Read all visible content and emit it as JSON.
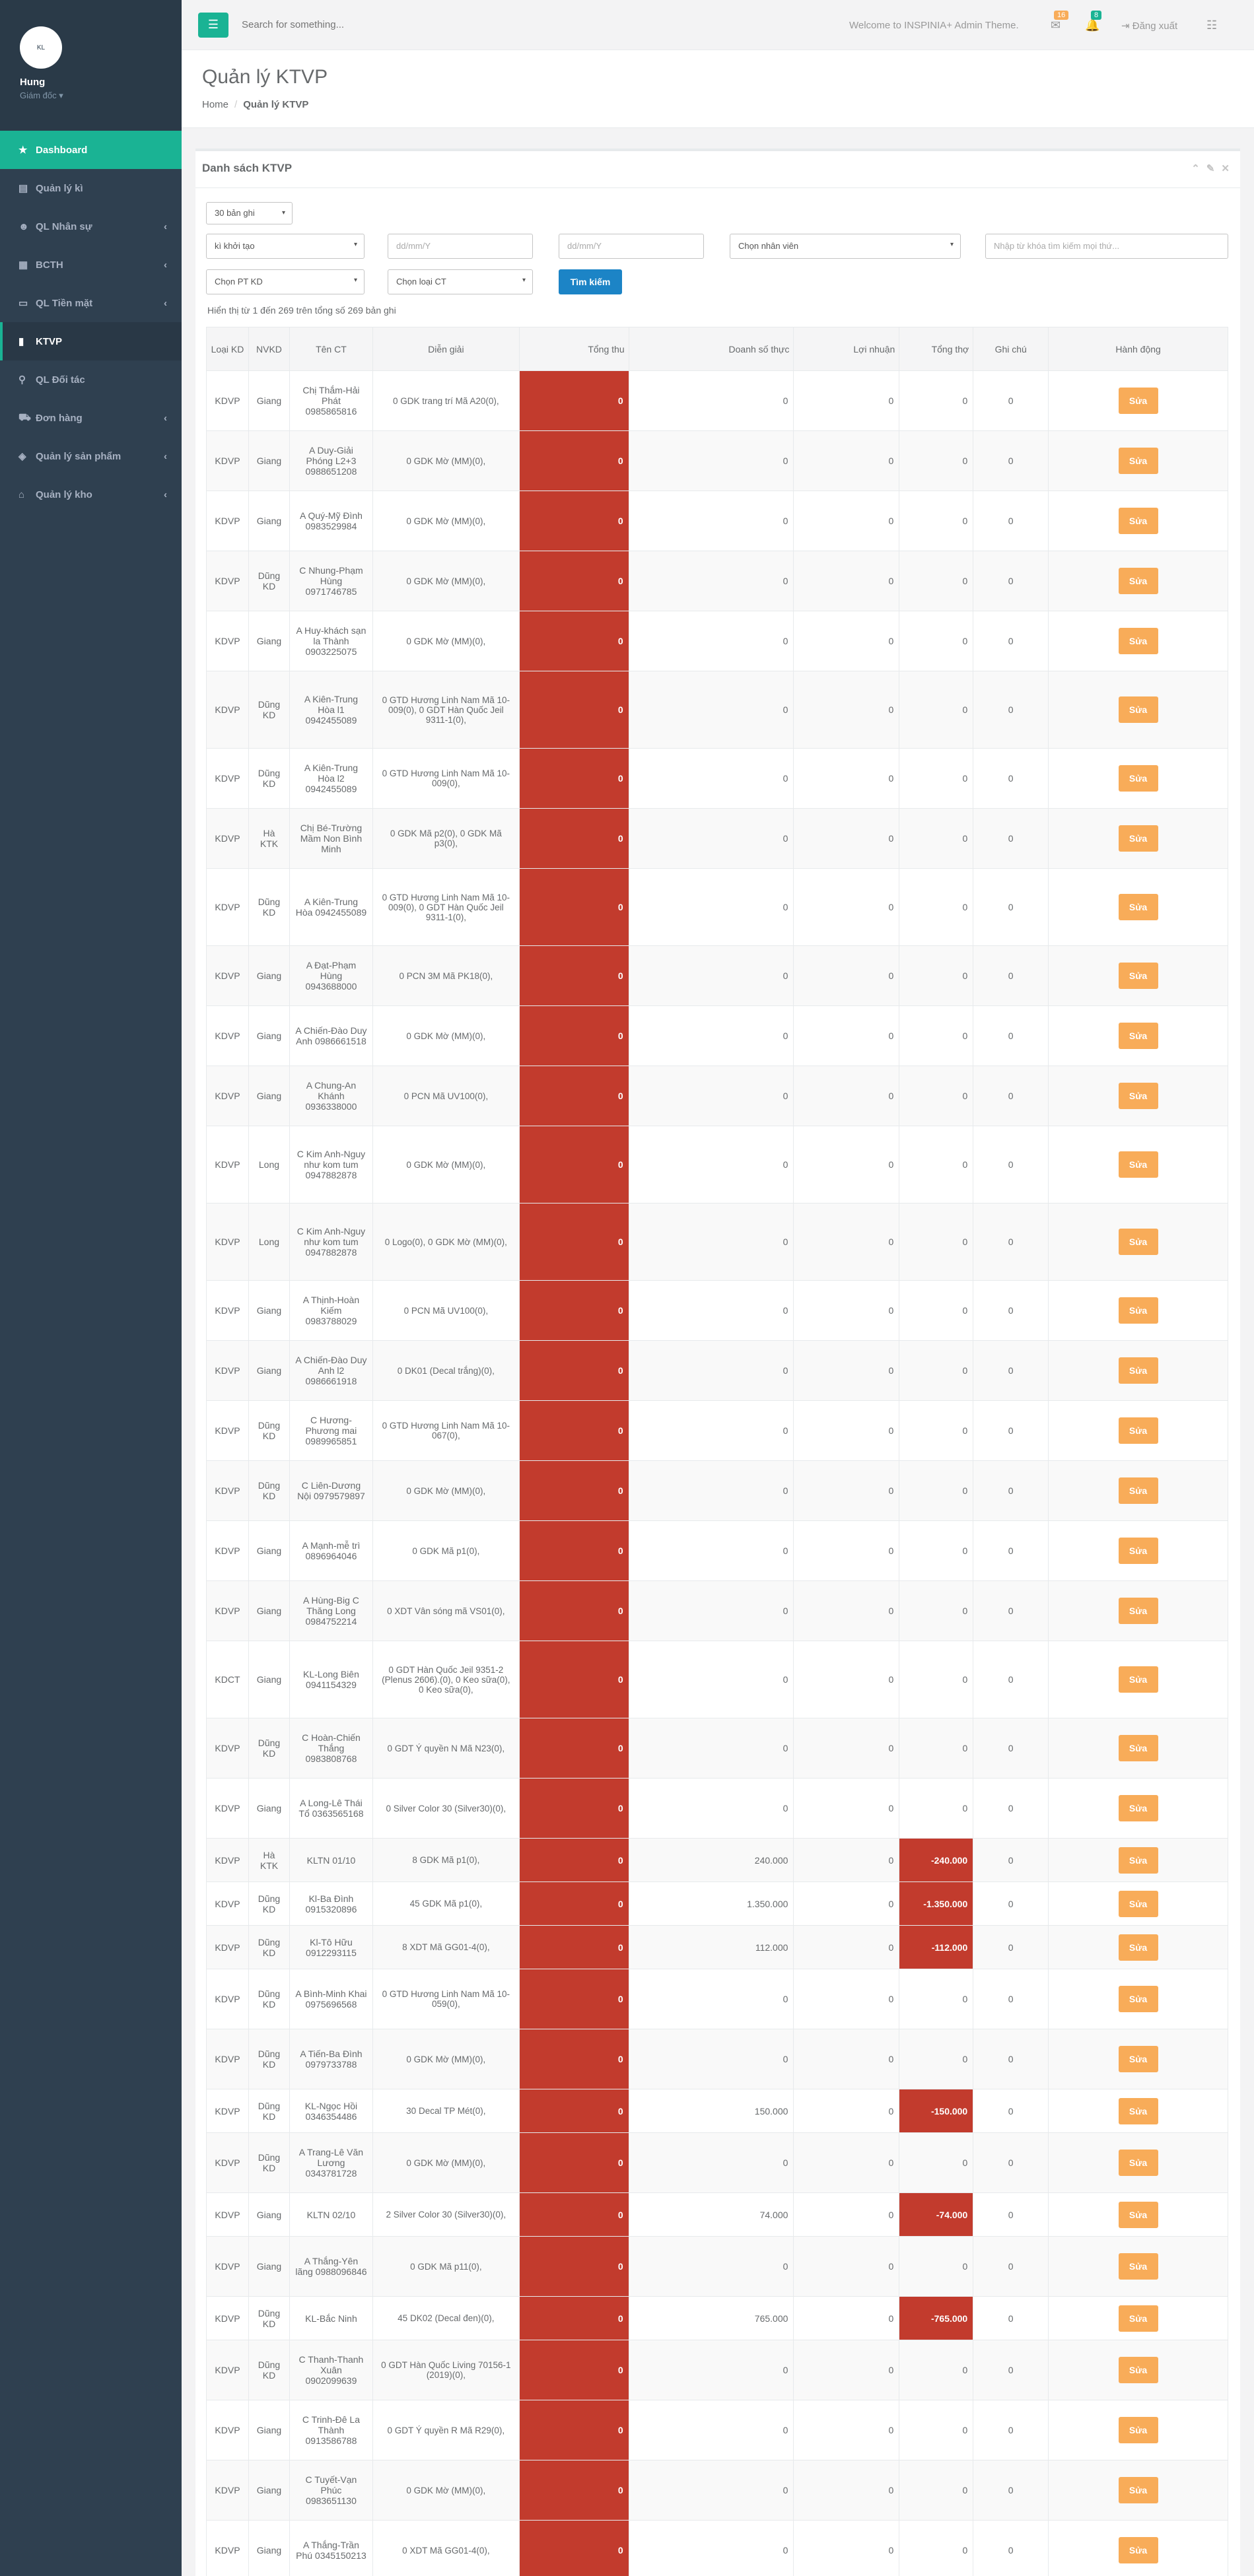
{
  "sidebar": {
    "avatar_text": "KL",
    "profile_name": "Hung",
    "profile_role": "Giám đốc",
    "items": [
      {
        "label": "Dashboard",
        "icon": "★"
      },
      {
        "label": "Quản lý kì",
        "icon": "▤"
      },
      {
        "label": "QL Nhân sự",
        "icon": "☻"
      },
      {
        "label": "BCTH",
        "icon": "▦"
      },
      {
        "label": "QL Tiền mặt",
        "icon": "▭"
      },
      {
        "label": "KTVP",
        "icon": "▮"
      },
      {
        "label": "QL Đối tác",
        "icon": "⚲"
      },
      {
        "label": "Đơn hàng",
        "icon": "⛟"
      },
      {
        "label": "Quản lý sản phẩm",
        "icon": "◈"
      },
      {
        "label": "Quản lý kho",
        "icon": "⌂"
      }
    ]
  },
  "topbar": {
    "search_placeholder": "Search for something...",
    "welcome": "Welcome to INSPINIA+ Admin Theme.",
    "mail_count": "16",
    "bell_count": "8",
    "logout": "Đăng xuất"
  },
  "heading": {
    "title": "Quản lý KTVP",
    "crumb_home": "Home",
    "crumb_current": "Quản lý KTVP"
  },
  "panel": {
    "title": "Danh sách KTVP",
    "page_size": "30 bản ghi",
    "ki_select": "kì khởi tạo",
    "date_from_placeholder": "dd/mm/Y",
    "date_to_placeholder": "dd/mm/Y",
    "staff_select": "Chọn nhân viên",
    "keyword_placeholder": "Nhập từ khóa tìm kiếm mọi thứ...",
    "pt_select": "Chọn PT KD",
    "ct_select": "Chọn loại CT",
    "search_button": "Tìm kiếm",
    "info": "Hiển thị từ 1 đến 269 trên tổng số 269 bản ghi"
  },
  "table": {
    "headers": [
      "Loại KD",
      "NVKD",
      "Tên CT",
      "Diễn giải",
      "Tổng thu",
      "Doanh số thực",
      "Lợi nhuận",
      "Tổng thợ",
      "Ghi chú",
      "Hành động"
    ],
    "edit_label": "Sửa",
    "rows": [
      {
        "loai": "KDVP",
        "nvkd": "Giang",
        "ten": "Chị Thắm-Hải Phát 0985865816",
        "dien": "0 GDK trang trí Mã A20(0),",
        "thu": "0",
        "ds": "0",
        "ln": "0",
        "tho": "0",
        "gc": "0"
      },
      {
        "loai": "KDVP",
        "nvkd": "Giang",
        "ten": "A Duy-Giải Phóng L2+3 0988651208",
        "dien": "0 GDK Mờ (MM)(0),",
        "thu": "0",
        "ds": "0",
        "ln": "0",
        "tho": "0",
        "gc": "0"
      },
      {
        "loai": "KDVP",
        "nvkd": "Giang",
        "ten": "A Quý-Mỹ Đình 0983529984",
        "dien": "0 GDK Mờ (MM)(0),",
        "thu": "0",
        "ds": "0",
        "ln": "0",
        "tho": "0",
        "gc": "0"
      },
      {
        "loai": "KDVP",
        "nvkd": "Dũng KD",
        "ten": "C Nhung-Phạm Hùng 0971746785",
        "dien": "0 GDK Mờ (MM)(0),",
        "thu": "0",
        "ds": "0",
        "ln": "0",
        "tho": "0",
        "gc": "0"
      },
      {
        "loai": "KDVP",
        "nvkd": "Giang",
        "ten": "A Huy-khách sạn la Thành 0903225075",
        "dien": "0 GDK Mờ (MM)(0),",
        "thu": "0",
        "ds": "0",
        "ln": "0",
        "tho": "0",
        "gc": "0"
      },
      {
        "loai": "KDVP",
        "nvkd": "Dũng KD",
        "ten": "A Kiên-Trung Hòa l1 0942455089",
        "dien": "0 GTD Hương Linh Nam Mã 10-009(0), 0 GDT Hàn Quốc Jeil 9311-1(0),",
        "thu": "0",
        "ds": "0",
        "ln": "0",
        "tho": "0",
        "gc": "0"
      },
      {
        "loai": "KDVP",
        "nvkd": "Dũng KD",
        "ten": "A Kiên-Trung Hòa l2 0942455089",
        "dien": "0 GTD Hương Linh Nam Mã 10-009(0),",
        "thu": "0",
        "ds": "0",
        "ln": "0",
        "tho": "0",
        "gc": "0"
      },
      {
        "loai": "KDVP",
        "nvkd": "Hà KTK",
        "ten": "Chị Bé-Trường Mầm Non Bình Minh",
        "dien": "0 GDK Mã p2(0), 0 GDK Mã p3(0),",
        "thu": "0",
        "ds": "0",
        "ln": "0",
        "tho": "0",
        "gc": "0"
      },
      {
        "loai": "KDVP",
        "nvkd": "Dũng KD",
        "ten": "A Kiên-Trung Hòa 0942455089",
        "dien": "0 GTD Hương Linh Nam Mã 10-009(0), 0 GDT Hàn Quốc Jeil 9311-1(0),",
        "thu": "0",
        "ds": "0",
        "ln": "0",
        "tho": "0",
        "gc": "0"
      },
      {
        "loai": "KDVP",
        "nvkd": "Giang",
        "ten": "A Đạt-Phạm Hùng 0943688000",
        "dien": "0 PCN 3M Mã PK18(0),",
        "thu": "0",
        "ds": "0",
        "ln": "0",
        "tho": "0",
        "gc": "0"
      },
      {
        "loai": "KDVP",
        "nvkd": "Giang",
        "ten": "A Chiến-Đào Duy Anh 0986661518",
        "dien": "0 GDK Mờ (MM)(0),",
        "thu": "0",
        "ds": "0",
        "ln": "0",
        "tho": "0",
        "gc": "0"
      },
      {
        "loai": "KDVP",
        "nvkd": "Giang",
        "ten": "A Chung-An Khánh 0936338000",
        "dien": "0 PCN Mã UV100(0),",
        "thu": "0",
        "ds": "0",
        "ln": "0",
        "tho": "0",
        "gc": "0"
      },
      {
        "loai": "KDVP",
        "nvkd": "Long",
        "ten": "C Kim Anh-Nguy như kom tum 0947882878",
        "dien": "0 GDK Mờ (MM)(0),",
        "thu": "0",
        "ds": "0",
        "ln": "0",
        "tho": "0",
        "gc": "0"
      },
      {
        "loai": "KDVP",
        "nvkd": "Long",
        "ten": "C Kim Anh-Nguy như kom tum 0947882878",
        "dien": "0 Logo(0), 0 GDK Mờ (MM)(0),",
        "thu": "0",
        "ds": "0",
        "ln": "0",
        "tho": "0",
        "gc": "0"
      },
      {
        "loai": "KDVP",
        "nvkd": "Giang",
        "ten": "A Thịnh-Hoàn Kiếm 0983788029",
        "dien": "0 PCN Mã UV100(0),",
        "thu": "0",
        "ds": "0",
        "ln": "0",
        "tho": "0",
        "gc": "0"
      },
      {
        "loai": "KDVP",
        "nvkd": "Giang",
        "ten": "A Chiến-Đào Duy Anh l2 0986661918",
        "dien": "0 DK01 (Decal trắng)(0),",
        "thu": "0",
        "ds": "0",
        "ln": "0",
        "tho": "0",
        "gc": "0"
      },
      {
        "loai": "KDVP",
        "nvkd": "Dũng KD",
        "ten": "C Hương-Phương mai 0989965851",
        "dien": "0 GTD Hương Linh Nam Mã 10-067(0),",
        "thu": "0",
        "ds": "0",
        "ln": "0",
        "tho": "0",
        "gc": "0"
      },
      {
        "loai": "KDVP",
        "nvkd": "Dũng KD",
        "ten": "C Liên-Dương Nội 0979579897",
        "dien": "0 GDK Mờ (MM)(0),",
        "thu": "0",
        "ds": "0",
        "ln": "0",
        "tho": "0",
        "gc": "0"
      },
      {
        "loai": "KDVP",
        "nvkd": "Giang",
        "ten": "A Mạnh-mễ trì 0896964046",
        "dien": "0 GDK Mã p1(0),",
        "thu": "0",
        "ds": "0",
        "ln": "0",
        "tho": "0",
        "gc": "0"
      },
      {
        "loai": "KDVP",
        "nvkd": "Giang",
        "ten": "A Hùng-Big C Thăng Long 0984752214",
        "dien": "0 XDT Vân sóng mã VS01(0),",
        "thu": "0",
        "ds": "0",
        "ln": "0",
        "tho": "0",
        "gc": "0"
      },
      {
        "loai": "KDCT",
        "nvkd": "Giang",
        "ten": "KL-Long Biên 0941154329",
        "dien": "0 GDT Hàn Quốc Jeil 9351-2 (Plenus 2606).(0), 0 Keo sữa(0), 0 Keo sữa(0),",
        "thu": "0",
        "ds": "0",
        "ln": "0",
        "tho": "0",
        "gc": "0"
      },
      {
        "loai": "KDVP",
        "nvkd": "Dũng KD",
        "ten": "C Hoàn-Chiến Thắng 0983808768",
        "dien": "0 GDT Ý quyền N Mã N23(0),",
        "thu": "0",
        "ds": "0",
        "ln": "0",
        "tho": "0",
        "gc": "0"
      },
      {
        "loai": "KDVP",
        "nvkd": "Giang",
        "ten": "A Long-Lê Thái Tổ 0363565168",
        "dien": "0 Silver Color 30 (Silver30)(0),",
        "thu": "0",
        "ds": "0",
        "ln": "0",
        "tho": "0",
        "gc": "0"
      },
      {
        "loai": "KDVP",
        "nvkd": "Hà KTK",
        "ten": "KLTN 01/10",
        "dien": "8 GDK Mã p1(0),",
        "thu": "0",
        "ds": "240.000",
        "ln": "0",
        "tho": "-240.000",
        "gc": "0",
        "red_tho": true
      },
      {
        "loai": "KDVP",
        "nvkd": "Dũng KD",
        "ten": "Kl-Ba Đình 0915320896",
        "dien": "45 GDK Mã p1(0),",
        "thu": "0",
        "ds": "1.350.000",
        "ln": "0",
        "tho": "-1.350.000",
        "gc": "0",
        "red_tho": true
      },
      {
        "loai": "KDVP",
        "nvkd": "Dũng KD",
        "ten": "Kl-Tô Hữu 0912293115",
        "dien": "8 XDT Mã GG01-4(0),",
        "thu": "0",
        "ds": "112.000",
        "ln": "0",
        "tho": "-112.000",
        "gc": "0",
        "red_tho": true
      },
      {
        "loai": "KDVP",
        "nvkd": "Dũng KD",
        "ten": "A Bình-Minh Khai 0975696568",
        "dien": "0 GTD Hương Linh Nam Mã 10-059(0),",
        "thu": "0",
        "ds": "0",
        "ln": "0",
        "tho": "0",
        "gc": "0"
      },
      {
        "loai": "KDVP",
        "nvkd": "Dũng KD",
        "ten": "A Tiến-Ba Đình 0979733788",
        "dien": "0 GDK Mờ (MM)(0),",
        "thu": "0",
        "ds": "0",
        "ln": "0",
        "tho": "0",
        "gc": "0"
      },
      {
        "loai": "KDVP",
        "nvkd": "Dũng KD",
        "ten": "KL-Ngọc Hồi 0346354486",
        "dien": "30 Decal TP Mét(0),",
        "thu": "0",
        "ds": "150.000",
        "ln": "0",
        "tho": "-150.000",
        "gc": "0",
        "red_tho": true
      },
      {
        "loai": "KDVP",
        "nvkd": "Dũng KD",
        "ten": "A Trang-Lê Văn Lương 0343781728",
        "dien": "0 GDK Mờ (MM)(0),",
        "thu": "0",
        "ds": "0",
        "ln": "0",
        "tho": "0",
        "gc": "0"
      },
      {
        "loai": "KDVP",
        "nvkd": "Giang",
        "ten": "KLTN 02/10",
        "dien": "2 Silver Color 30 (Silver30)(0),",
        "thu": "0",
        "ds": "74.000",
        "ln": "0",
        "tho": "-74.000",
        "gc": "0",
        "red_tho": true
      },
      {
        "loai": "KDVP",
        "nvkd": "Giang",
        "ten": "A Thắng-Yên lãng 0988096846",
        "dien": "0 GDK Mã p11(0),",
        "thu": "0",
        "ds": "0",
        "ln": "0",
        "tho": "0",
        "gc": "0"
      },
      {
        "loai": "KDVP",
        "nvkd": "Dũng KD",
        "ten": "KL-Bắc Ninh",
        "dien": "45 DK02 (Decal đen)(0),",
        "thu": "0",
        "ds": "765.000",
        "ln": "0",
        "tho": "-765.000",
        "gc": "0",
        "red_tho": true
      },
      {
        "loai": "KDVP",
        "nvkd": "Dũng KD",
        "ten": "C Thanh-Thanh Xuân 0902099639",
        "dien": "0 GDT Hàn Quốc Living 70156-1 (2019)(0),",
        "thu": "0",
        "ds": "0",
        "ln": "0",
        "tho": "0",
        "gc": "0"
      },
      {
        "loai": "KDVP",
        "nvkd": "Giang",
        "ten": "C Trinh-Đê La Thành 0913586788",
        "dien": "0 GDT Ý quyền R Mã R29(0),",
        "thu": "0",
        "ds": "0",
        "ln": "0",
        "tho": "0",
        "gc": "0"
      },
      {
        "loai": "KDVP",
        "nvkd": "Giang",
        "ten": "C Tuyết-Vạn Phúc 0983651130",
        "dien": "0 GDK Mờ (MM)(0),",
        "thu": "0",
        "ds": "0",
        "ln": "0",
        "tho": "0",
        "gc": "0"
      },
      {
        "loai": "KDVP",
        "nvkd": "Giang",
        "ten": "A Thắng-Trần Phú 0345150213",
        "dien": "0 XDT Mã GG01-4(0),",
        "thu": "0",
        "ds": "0",
        "ln": "0",
        "tho": "0",
        "gc": "0"
      }
    ]
  }
}
